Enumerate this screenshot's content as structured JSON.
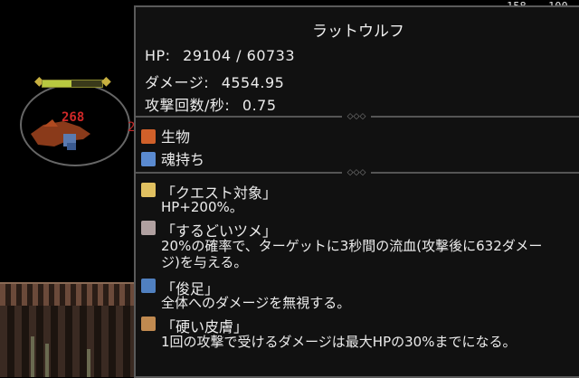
{
  "background": {
    "top_numbers": [
      "158",
      "100"
    ]
  },
  "enemy": {
    "damage_popup": "268",
    "damage_popup_partial": "2",
    "hp_fraction": 0.48
  },
  "tooltip": {
    "title": "ラットウルフ",
    "stats": {
      "hp_label": "HP:",
      "hp_value": "29104 / 60733",
      "damage_label": "ダメージ:",
      "damage_value": "4554.95",
      "attacks_label": "攻撃回数/秒:",
      "attacks_value": "0.75"
    },
    "traits": [
      {
        "label": "生物",
        "icon": "creature-icon",
        "color": "#d0602a"
      },
      {
        "label": "魂持ち",
        "icon": "soul-icon",
        "color": "#5a8ad0"
      }
    ],
    "abilities": [
      {
        "name": "「クエスト対象」",
        "desc": "HP+200%。",
        "icon": "quest-crown-icon",
        "color": "#e0c060"
      },
      {
        "name": "「するどいツメ」",
        "desc": "20%の確率で、ターゲットに3秒間の流血(攻撃後に632ダメージ)を与える。",
        "icon": "claw-icon",
        "color": "#b0a0a0"
      },
      {
        "name": "「俊足」",
        "desc": "全体へのダメージを無視する。",
        "icon": "swift-foot-icon",
        "color": "#5080c0"
      },
      {
        "name": "「硬い皮膚」",
        "desc": "1回の攻撃で受けるダメージは最大HPの30%までになる。",
        "icon": "tough-skin-icon",
        "color": "#c08a50"
      }
    ]
  }
}
